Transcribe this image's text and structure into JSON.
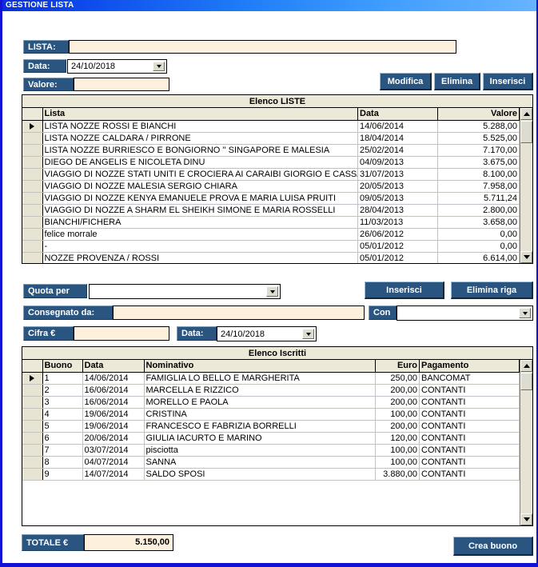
{
  "window": {
    "title": "GESTIONE LISTA"
  },
  "header_form": {
    "lista_label": "LISTA:",
    "lista_value": "",
    "data_label": "Data:",
    "data_value": "24/10/2018",
    "valore_label": "Valore:",
    "valore_value": "",
    "buttons": {
      "modifica": "Modifica",
      "elimina": "Elimina",
      "inserisci": "Inserisci"
    }
  },
  "liste_grid": {
    "caption": "Elenco LISTE",
    "columns": [
      "",
      "Lista",
      "Data",
      "Valore"
    ],
    "selected_row": 0,
    "rows": [
      {
        "lista": "LISTA NOZZE ROSSI  E BIANCHI",
        "data": "14/06/2014",
        "valore": "5.288,00"
      },
      {
        "lista": "LISTA NOZZE CALDARA / PIRRONE",
        "data": "18/04/2014",
        "valore": "5.525,00"
      },
      {
        "lista": "LISTA NOZZE BURRIESCO  E BONGIORNO  '' SINGAPORE E MALESIA",
        "data": "25/02/2014",
        "valore": "7.170,00"
      },
      {
        "lista": " DIEGO DE ANGELIS E NICOLETA DINU",
        "data": "04/09/2013",
        "valore": "3.675,00"
      },
      {
        "lista": "VIAGGIO DI NOZZE STATI UNITI E CROCIERA AI CARAIBI GIORGIO  E CASSA",
        "data": "31/07/2013",
        "valore": "8.100,00"
      },
      {
        "lista": "VIAGGIO DI NOZZE MALESIA  SERGIO CHIARA",
        "data": "20/05/2013",
        "valore": "7.958,00"
      },
      {
        "lista": "VIAGGIO DI NOZZE KENYA EMANUELE PROVA E MARIA LUISA PRUITI",
        "data": "09/05/2013",
        "valore": "5.711,24"
      },
      {
        "lista": "VIAGGIO DI NOZZE A SHARM EL SHEIKH SIMONE  E MARIA ROSSELLI",
        "data": "28/04/2013",
        "valore": "2.800,00"
      },
      {
        "lista": "BIANCHI/FICHERA",
        "data": "11/03/2013",
        "valore": "3.658,00"
      },
      {
        "lista": "felice morrale",
        "data": "26/06/2012",
        "valore": "0,00"
      },
      {
        "lista": "-",
        "data": "05/01/2012",
        "valore": "0,00"
      },
      {
        "lista": "NOZZE PROVENZA / ROSSI",
        "data": "05/01/2012",
        "valore": "6.614,00"
      }
    ]
  },
  "iscritti_form": {
    "quota_label": "Quota per",
    "quota_value": "",
    "consegnato_label": "Consegnato da:",
    "consegnato_value": "",
    "con_label": "Con",
    "con_value": "",
    "cifra_label": "Cifra €",
    "cifra_value": "",
    "data_label": "Data:",
    "data_value": "24/10/2018",
    "buttons": {
      "inserisci": "Inserisci",
      "elimina_riga": "Elimina riga"
    }
  },
  "iscritti_grid": {
    "caption": "Elenco Iscritti",
    "columns": [
      "",
      "Buono",
      "Data",
      "Nominativo",
      "Euro",
      "Pagamento"
    ],
    "selected_row": 0,
    "rows": [
      {
        "buono": "1",
        "data": "14/06/2014",
        "nominativo": "FAMIGLIA LO BELLO E MARGHERITA",
        "euro": "250,00",
        "pagamento": "BANCOMAT"
      },
      {
        "buono": "2",
        "data": "16/06/2014",
        "nominativo": "MARCELLA E RIZZICO",
        "euro": "200,00",
        "pagamento": "CONTANTI"
      },
      {
        "buono": "3",
        "data": "16/06/2014",
        "nominativo": "MORELLO E PAOLA",
        "euro": "200,00",
        "pagamento": "CONTANTI"
      },
      {
        "buono": "4",
        "data": "19/06/2014",
        "nominativo": "CRISTINA",
        "euro": "100,00",
        "pagamento": "CONTANTI"
      },
      {
        "buono": "5",
        "data": "19/06/2014",
        "nominativo": "FRANCESCO E FABRIZIA BORRELLI",
        "euro": "200,00",
        "pagamento": "CONTANTI"
      },
      {
        "buono": "6",
        "data": "20/06/2014",
        "nominativo": "GIULIA IACURTO E MARINO",
        "euro": "120,00",
        "pagamento": "CONTANTI"
      },
      {
        "buono": "7",
        "data": "03/07/2014",
        "nominativo": "pisciotta",
        "euro": "100,00",
        "pagamento": "CONTANTI"
      },
      {
        "buono": "8",
        "data": "04/07/2014",
        "nominativo": "SANNA",
        "euro": "100,00",
        "pagamento": "CONTANTI"
      },
      {
        "buono": "9",
        "data": "14/07/2014",
        "nominativo": "SALDO SPOSI",
        "euro": "3.880,00",
        "pagamento": "CONTANTI"
      }
    ]
  },
  "footer": {
    "totale_label": "TOTALE €",
    "totale_value": "5.150,00",
    "crea_buono_label": "Crea buono"
  }
}
